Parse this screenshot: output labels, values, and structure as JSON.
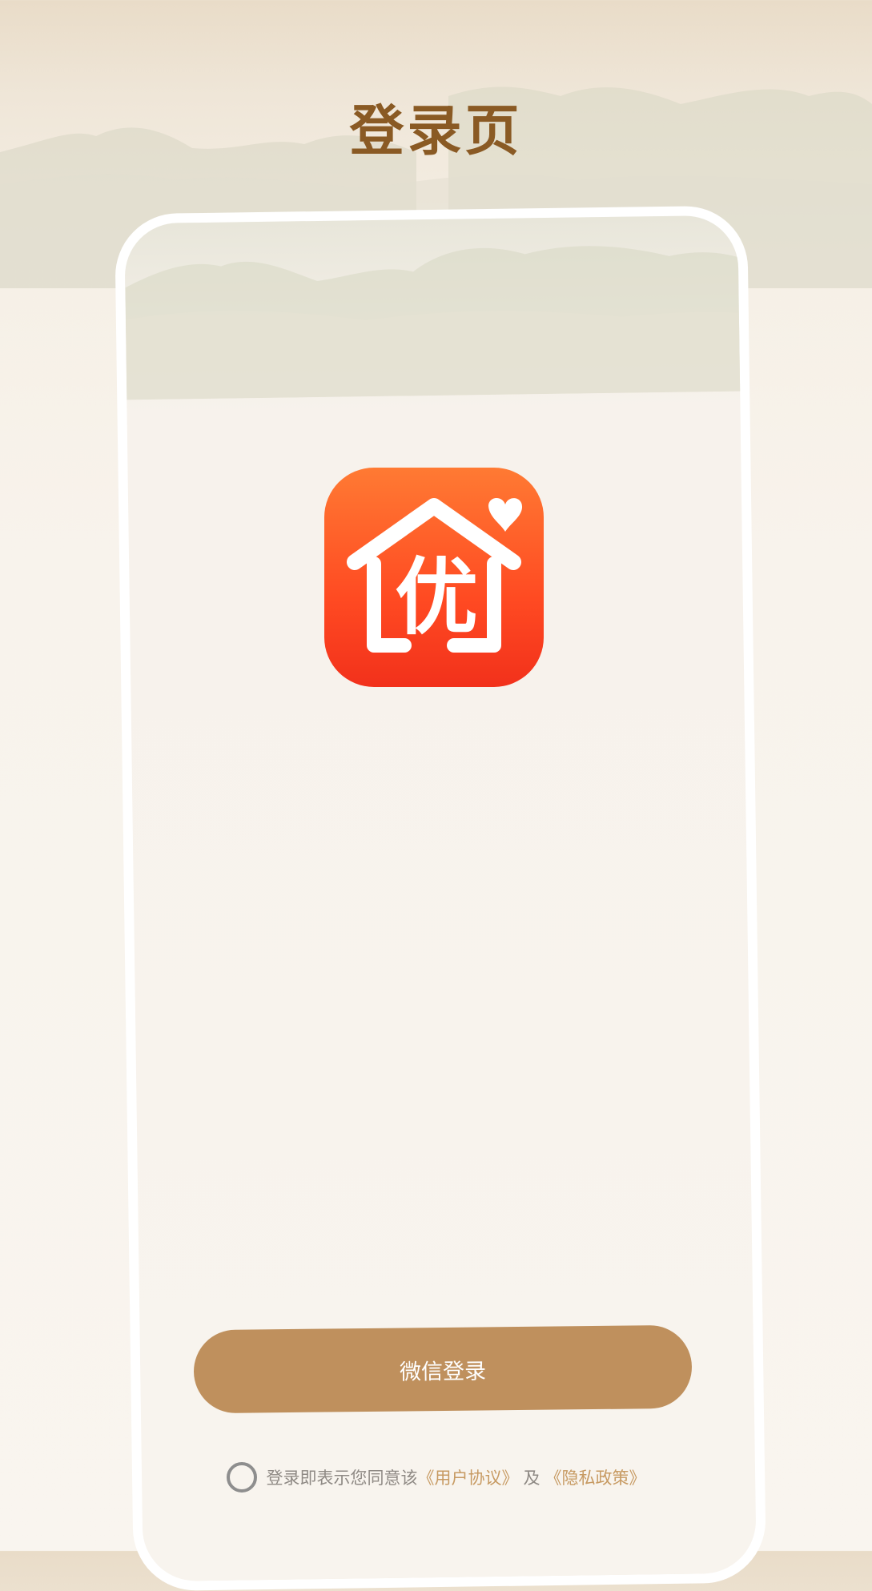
{
  "header": {
    "title": "登录页"
  },
  "logo": {
    "icon": "house-heart-you-logo-icon",
    "glyph": "优"
  },
  "login": {
    "button_label": "微信登录"
  },
  "agreement": {
    "prefix": "登录即表示您同意该",
    "user_agreement_link": "《用户协议》",
    "conjunction": "及",
    "privacy_policy_link": "《隐私政策》"
  },
  "colors": {
    "title": "#8a5a24",
    "button": "#bf905d",
    "link": "#c79a62",
    "logo_top": "#ff7a33",
    "logo_bottom": "#f2311b"
  }
}
